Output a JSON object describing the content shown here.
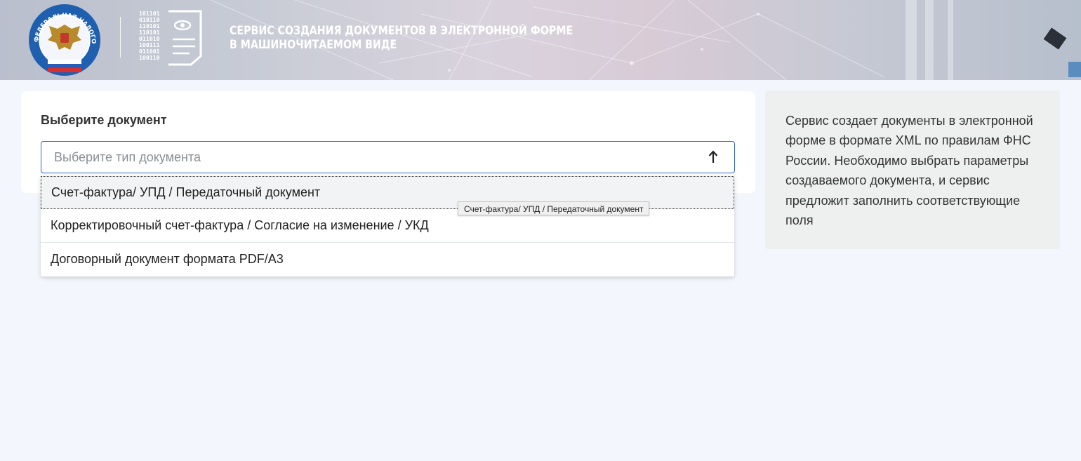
{
  "header": {
    "emblem_text": "ФЕДЕРАЛЬНАЯ НАЛОГОВАЯ СЛУЖБА",
    "binary_lines": [
      "101101",
      "010110",
      "110101",
      "110101",
      "011010",
      "100111",
      "011001",
      "100110"
    ],
    "title_line1": "СЕРВИС СОЗДАНИЯ ДОКУМЕНТОВ В ЭЛЕКТРОННОЙ ФОРМЕ",
    "title_line2": "В МАШИНОЧИТАЕМОМ ВИДЕ"
  },
  "form": {
    "label": "Выберите документ",
    "select": {
      "placeholder": "Выберите тип документа",
      "icon": "arrow-up-icon"
    },
    "options": [
      "Счет-фактура/ УПД / Передаточный документ",
      "Корректировочный счет-фактура / Согласие на изменение / УКД",
      "Договорный документ формата PDF/A3"
    ],
    "tooltip": "Счет-фактура/ УПД / Передаточный документ"
  },
  "info": {
    "text": "Сервис создает документы в электронной форме в формате XML по правилам ФНС России. Необходимо выбрать параметры создаваемого документа, и сервис предложит заполнить соответствующие поля"
  },
  "colors": {
    "page_bg": "#f3f7fd",
    "accent_border": "#2f65c8",
    "emblem_blue": "#1f5fb0",
    "info_bg": "#eef0ef"
  }
}
